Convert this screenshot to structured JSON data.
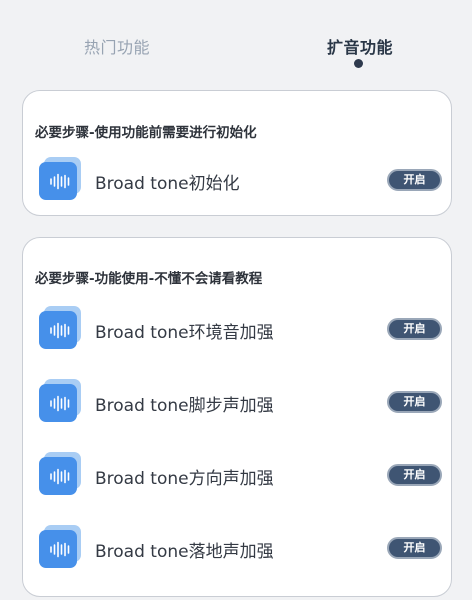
{
  "tabs": {
    "hot": "热门功能",
    "expand": "扩音功能"
  },
  "section1": {
    "heading": "必要步骤-使用功能前需要进行初始化",
    "rows": [
      {
        "label": "Broad tone初始化",
        "button": "开启",
        "icon": "audio-wave-icon"
      }
    ]
  },
  "section2": {
    "heading": "必要步骤-功能使用-不懂不会请看教程",
    "rows": [
      {
        "label": "Broad tone环境音加强",
        "button": "开启",
        "icon": "audio-wave-icon"
      },
      {
        "label": "Broad tone脚步声加强",
        "button": "开启",
        "icon": "audio-wave-icon"
      },
      {
        "label": "Broad tone方向声加强",
        "button": "开启",
        "icon": "audio-wave-icon"
      },
      {
        "label": "Broad tone落地声加强",
        "button": "开启",
        "icon": "audio-wave-icon"
      }
    ]
  },
  "colors": {
    "accent_icon": "#4690ea",
    "button_bg": "#3f5573",
    "active_tab": "#2a3747",
    "inactive_tab": "#97a3b2"
  }
}
